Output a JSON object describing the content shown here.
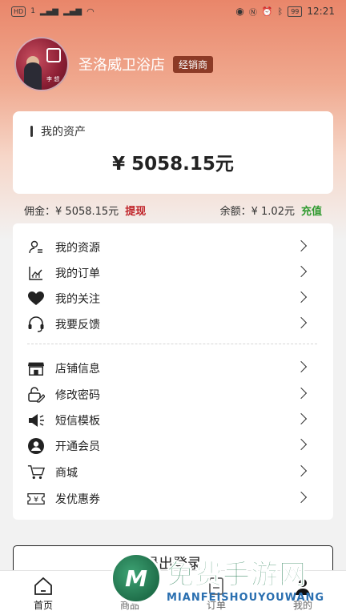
{
  "status_bar": {
    "left_chips": [
      "HD",
      "1",
      "4G",
      "4G"
    ],
    "battery": "99",
    "time": "12:21"
  },
  "profile": {
    "shop_name": "圣洛威卫浴店",
    "role_badge": "经销商",
    "avatar_name_mark": "李 想"
  },
  "assets": {
    "title": "我的资产",
    "amount": "¥ 5058.15元"
  },
  "balance": {
    "commission_label": "佣金：",
    "commission_value": "¥ 5058.15元",
    "withdraw": "提现",
    "remain_label": "余额：",
    "remain_value": "¥ 1.02元",
    "recharge": "充值"
  },
  "menu": {
    "group1": [
      {
        "label": "我的资源",
        "icon": "user-list-icon"
      },
      {
        "label": "我的订单",
        "icon": "chart-icon"
      },
      {
        "label": "我的关注",
        "icon": "heart-icon"
      },
      {
        "label": "我要反馈",
        "icon": "headset-icon"
      }
    ],
    "group2": [
      {
        "label": "店铺信息",
        "icon": "store-icon"
      },
      {
        "label": "修改密码",
        "icon": "edit-lock-icon"
      },
      {
        "label": "短信模板",
        "icon": "megaphone-icon"
      },
      {
        "label": "开通会员",
        "icon": "member-icon"
      },
      {
        "label": "商城",
        "icon": "cart-icon"
      },
      {
        "label": "发优惠券",
        "icon": "coupon-icon"
      }
    ]
  },
  "logout": "退出登录",
  "tabs": [
    {
      "label": "首页",
      "icon": "home-icon"
    },
    {
      "label": "商品",
      "icon": "goods-icon"
    },
    {
      "label": "订单",
      "icon": "order-icon"
    },
    {
      "label": "我的",
      "icon": "profile-icon"
    }
  ],
  "watermark": {
    "cn": "免费手游网",
    "en": "MIANFEISHOUYOUWANG"
  }
}
